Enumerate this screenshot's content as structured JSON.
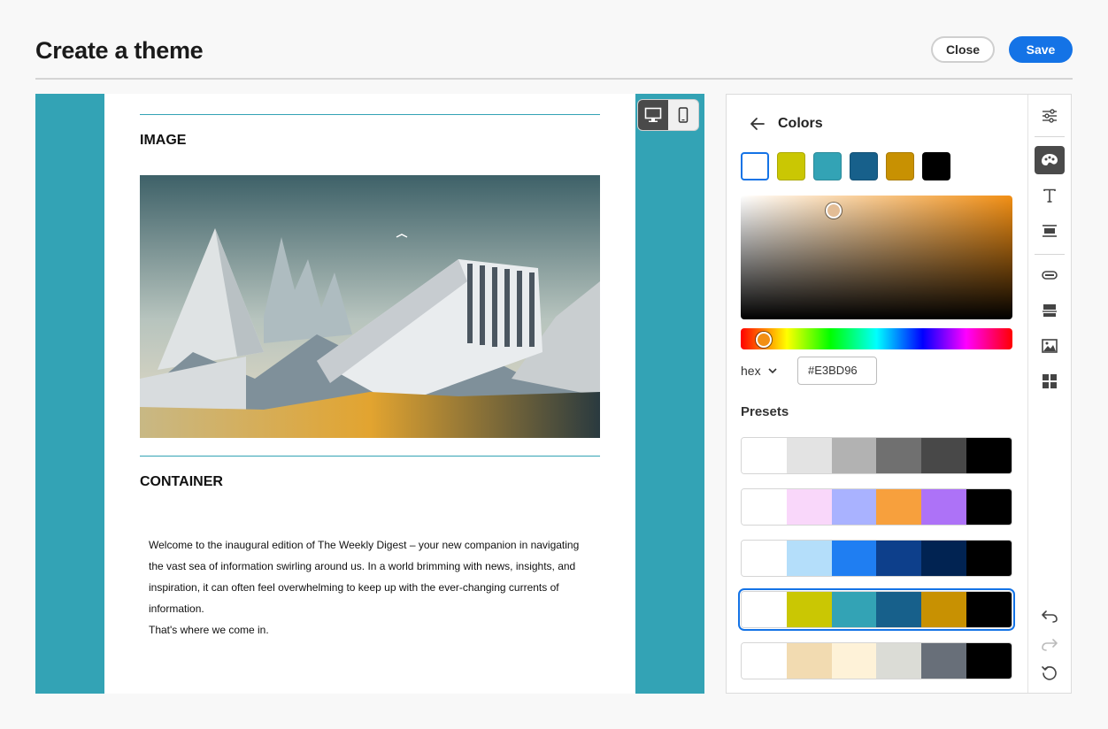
{
  "header": {
    "title": "Create a theme",
    "close_label": "Close",
    "save_label": "Save"
  },
  "canvas": {
    "sections": {
      "image_heading": "IMAGE",
      "container_heading": "CONTAINER"
    },
    "body_paragraphs": [
      "Welcome to the inaugural edition of The Weekly Digest – your new companion in navigating the vast sea of information swirling around us. In a world brimming with news, insights, and inspiration, it can often feel overwhelming to keep up with the ever-changing currents of information.",
      "That's where we come in."
    ],
    "device_toggle": {
      "active": "desktop-icon",
      "inactive": "mobile-icon"
    }
  },
  "colors_panel": {
    "title": "Colors",
    "swatches": [
      "#ffffff",
      "#cac703",
      "#33a3b5",
      "#17608b",
      "#c89102",
      "#000000"
    ],
    "selected_swatch": 0,
    "picker": {
      "hex": "#E3BD96",
      "format_label": "hex",
      "hue_color": "#f28f14"
    },
    "presets_label": "Presets",
    "presets": [
      [
        "#ffffff",
        "#e3e3e3",
        "#b2b2b2",
        "#707070",
        "#484848",
        "#000000"
      ],
      [
        "#ffffff",
        "#f9d7fa",
        "#a9b2ff",
        "#f7a03d",
        "#ad72f7",
        "#000000"
      ],
      [
        "#ffffff",
        "#b4defa",
        "#1f7ef2",
        "#0d3f8b",
        "#012352",
        "#000000"
      ],
      [
        "#ffffff",
        "#cac703",
        "#33a3b5",
        "#17608b",
        "#c89102",
        "#000000"
      ],
      [
        "#ffffff",
        "#f2dbb1",
        "#fef2d8",
        "#dbdcd6",
        "#686f79",
        "#000000"
      ]
    ],
    "selected_preset": 3
  },
  "toolbar": {
    "icons": [
      "sliders-icon",
      "palette-icon",
      "text-icon",
      "divider-icon",
      "button-icon",
      "container-icon",
      "image-icon",
      "grid-icon",
      "undo-icon",
      "redo-icon",
      "reset-icon"
    ],
    "active": "palette-icon"
  }
}
